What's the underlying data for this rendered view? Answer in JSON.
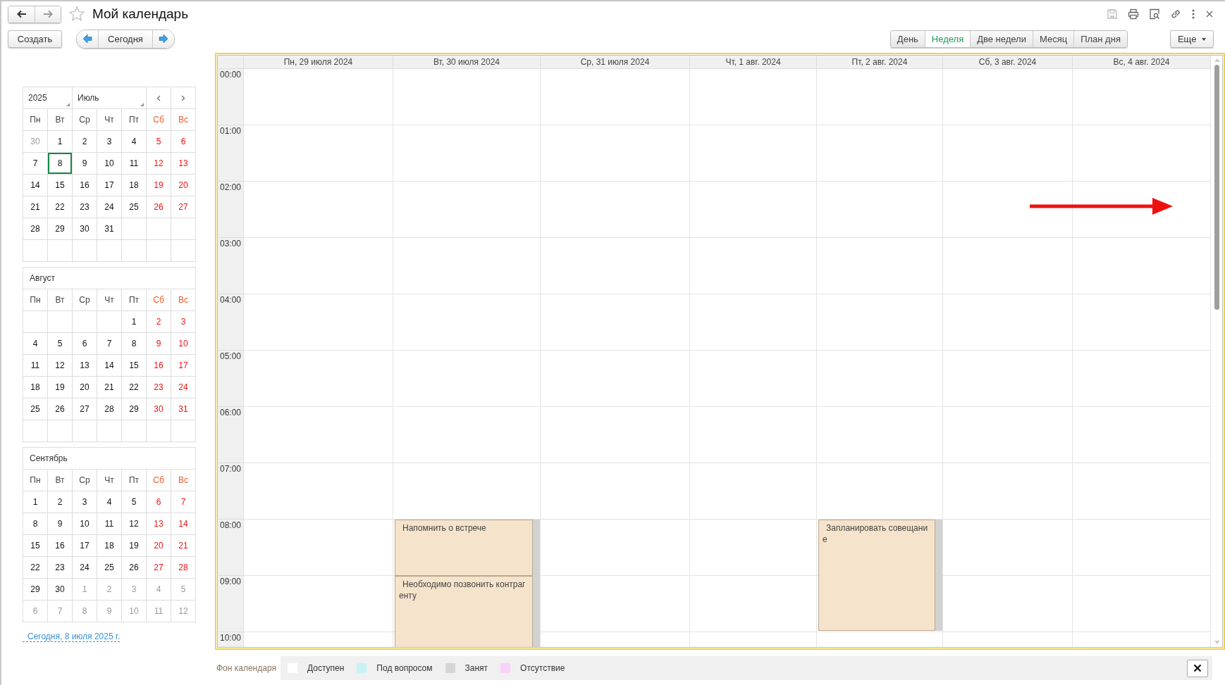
{
  "window": {
    "title": "Мой календарь",
    "favorite": false
  },
  "toolbar": {
    "create": "Создать",
    "today": "Сегодня",
    "more": "Еще",
    "views": [
      {
        "label": "День",
        "selected": false
      },
      {
        "label": "Неделя",
        "selected": true
      },
      {
        "label": "Две недели",
        "selected": false
      },
      {
        "label": "Месяц",
        "selected": false
      },
      {
        "label": "План дня",
        "selected": false
      }
    ]
  },
  "mini_calendars": [
    {
      "kind": "selector",
      "year": "2025",
      "month": "Июль",
      "weekdays": [
        {
          "label": "Пн",
          "weekend": false
        },
        {
          "label": "Вт",
          "weekend": false
        },
        {
          "label": "Ср",
          "weekend": false
        },
        {
          "label": "Чт",
          "weekend": false
        },
        {
          "label": "Пт",
          "weekend": false
        },
        {
          "label": "Сб",
          "weekend": true
        },
        {
          "label": "Вс",
          "weekend": true
        }
      ],
      "weeks": [
        [
          {
            "kind": "other",
            "text": "30",
            "selected": false
          },
          {
            "kind": "day",
            "text": "1",
            "selected": false
          },
          {
            "kind": "day",
            "text": "2",
            "selected": false
          },
          {
            "kind": "day",
            "text": "3",
            "selected": false
          },
          {
            "kind": "day",
            "text": "4",
            "selected": false
          },
          {
            "kind": "day",
            "text": "5",
            "selected": false
          },
          {
            "kind": "day",
            "text": "6",
            "selected": false
          }
        ],
        [
          {
            "kind": "day",
            "text": "7",
            "selected": false
          },
          {
            "kind": "day",
            "text": "8",
            "selected": true
          },
          {
            "kind": "day",
            "text": "9",
            "selected": false
          },
          {
            "kind": "day",
            "text": "10",
            "selected": false
          },
          {
            "kind": "day",
            "text": "11",
            "selected": false
          },
          {
            "kind": "day",
            "text": "12",
            "selected": false
          },
          {
            "kind": "day",
            "text": "13",
            "selected": false
          }
        ],
        [
          {
            "kind": "day",
            "text": "14",
            "selected": false
          },
          {
            "kind": "day",
            "text": "15",
            "selected": false
          },
          {
            "kind": "day",
            "text": "16",
            "selected": false
          },
          {
            "kind": "day",
            "text": "17",
            "selected": false
          },
          {
            "kind": "day",
            "text": "18",
            "selected": false
          },
          {
            "kind": "day",
            "text": "19",
            "selected": false
          },
          {
            "kind": "day",
            "text": "20",
            "selected": false
          }
        ],
        [
          {
            "kind": "day",
            "text": "21",
            "selected": false
          },
          {
            "kind": "day",
            "text": "22",
            "selected": false
          },
          {
            "kind": "day",
            "text": "23",
            "selected": false
          },
          {
            "kind": "day",
            "text": "24",
            "selected": false
          },
          {
            "kind": "day",
            "text": "25",
            "selected": false
          },
          {
            "kind": "day",
            "text": "26",
            "selected": false
          },
          {
            "kind": "day",
            "text": "27",
            "selected": false
          }
        ],
        [
          {
            "kind": "day",
            "text": "28",
            "selected": false
          },
          {
            "kind": "day",
            "text": "29",
            "selected": false
          },
          {
            "kind": "day",
            "text": "30",
            "selected": false
          },
          {
            "kind": "day",
            "text": "31",
            "selected": false
          },
          {
            "kind": "empty",
            "selected": false
          },
          {
            "kind": "empty",
            "selected": false
          },
          {
            "kind": "empty",
            "selected": false
          }
        ],
        [
          {
            "kind": "empty",
            "selected": false
          },
          {
            "kind": "empty",
            "selected": false
          },
          {
            "kind": "empty",
            "selected": false
          },
          {
            "kind": "empty",
            "selected": false
          },
          {
            "kind": "empty",
            "selected": false
          },
          {
            "kind": "empty",
            "selected": false
          },
          {
            "kind": "empty",
            "selected": false
          }
        ]
      ]
    },
    {
      "kind": "plain",
      "month": "Август",
      "weekdays": [
        {
          "label": "Пн",
          "weekend": false
        },
        {
          "label": "Вт",
          "weekend": false
        },
        {
          "label": "Ср",
          "weekend": false
        },
        {
          "label": "Чт",
          "weekend": false
        },
        {
          "label": "Пт",
          "weekend": false
        },
        {
          "label": "Сб",
          "weekend": true
        },
        {
          "label": "Вс",
          "weekend": true
        }
      ],
      "weeks": [
        [
          {
            "kind": "empty",
            "selected": false
          },
          {
            "kind": "empty",
            "selected": false
          },
          {
            "kind": "empty",
            "selected": false
          },
          {
            "kind": "empty",
            "selected": false
          },
          {
            "kind": "day",
            "text": "1",
            "selected": false
          },
          {
            "kind": "day",
            "text": "2",
            "selected": false
          },
          {
            "kind": "day",
            "text": "3",
            "selected": false
          }
        ],
        [
          {
            "kind": "day",
            "text": "4",
            "selected": false
          },
          {
            "kind": "day",
            "text": "5",
            "selected": false
          },
          {
            "kind": "day",
            "text": "6",
            "selected": false
          },
          {
            "kind": "day",
            "text": "7",
            "selected": false
          },
          {
            "kind": "day",
            "text": "8",
            "selected": false
          },
          {
            "kind": "day",
            "text": "9",
            "selected": false
          },
          {
            "kind": "day",
            "text": "10",
            "selected": false
          }
        ],
        [
          {
            "kind": "day",
            "text": "11",
            "selected": false
          },
          {
            "kind": "day",
            "text": "12",
            "selected": false
          },
          {
            "kind": "day",
            "text": "13",
            "selected": false
          },
          {
            "kind": "day",
            "text": "14",
            "selected": false
          },
          {
            "kind": "day",
            "text": "15",
            "selected": false
          },
          {
            "kind": "day",
            "text": "16",
            "selected": false
          },
          {
            "kind": "day",
            "text": "17",
            "selected": false
          }
        ],
        [
          {
            "kind": "day",
            "text": "18",
            "selected": false
          },
          {
            "kind": "day",
            "text": "19",
            "selected": false
          },
          {
            "kind": "day",
            "text": "20",
            "selected": false
          },
          {
            "kind": "day",
            "text": "21",
            "selected": false
          },
          {
            "kind": "day",
            "text": "22",
            "selected": false
          },
          {
            "kind": "day",
            "text": "23",
            "selected": false
          },
          {
            "kind": "day",
            "text": "24",
            "selected": false
          }
        ],
        [
          {
            "kind": "day",
            "text": "25",
            "selected": false
          },
          {
            "kind": "day",
            "text": "26",
            "selected": false
          },
          {
            "kind": "day",
            "text": "27",
            "selected": false
          },
          {
            "kind": "day",
            "text": "28",
            "selected": false
          },
          {
            "kind": "day",
            "text": "29",
            "selected": false
          },
          {
            "kind": "day",
            "text": "30",
            "selected": false
          },
          {
            "kind": "day",
            "text": "31",
            "selected": false
          }
        ],
        [
          {
            "kind": "empty",
            "selected": false
          },
          {
            "kind": "empty",
            "selected": false
          },
          {
            "kind": "empty",
            "selected": false
          },
          {
            "kind": "empty",
            "selected": false
          },
          {
            "kind": "empty",
            "selected": false
          },
          {
            "kind": "empty",
            "selected": false
          },
          {
            "kind": "empty",
            "selected": false
          }
        ]
      ]
    },
    {
      "kind": "plain",
      "month": "Сентябрь",
      "weekdays": [
        {
          "label": "Пн",
          "weekend": false
        },
        {
          "label": "Вт",
          "weekend": false
        },
        {
          "label": "Ср",
          "weekend": false
        },
        {
          "label": "Чт",
          "weekend": false
        },
        {
          "label": "Пт",
          "weekend": false
        },
        {
          "label": "Сб",
          "weekend": true
        },
        {
          "label": "Вс",
          "weekend": true
        }
      ],
      "weeks": [
        [
          {
            "kind": "day",
            "text": "1",
            "selected": false
          },
          {
            "kind": "day",
            "text": "2",
            "selected": false
          },
          {
            "kind": "day",
            "text": "3",
            "selected": false
          },
          {
            "kind": "day",
            "text": "4",
            "selected": false
          },
          {
            "kind": "day",
            "text": "5",
            "selected": false
          },
          {
            "kind": "day",
            "text": "6",
            "selected": false
          },
          {
            "kind": "day",
            "text": "7",
            "selected": false
          }
        ],
        [
          {
            "kind": "day",
            "text": "8",
            "selected": false
          },
          {
            "kind": "day",
            "text": "9",
            "selected": false
          },
          {
            "kind": "day",
            "text": "10",
            "selected": false
          },
          {
            "kind": "day",
            "text": "11",
            "selected": false
          },
          {
            "kind": "day",
            "text": "12",
            "selected": false
          },
          {
            "kind": "day",
            "text": "13",
            "selected": false
          },
          {
            "kind": "day",
            "text": "14",
            "selected": false
          }
        ],
        [
          {
            "kind": "day",
            "text": "15",
            "selected": false
          },
          {
            "kind": "day",
            "text": "16",
            "selected": false
          },
          {
            "kind": "day",
            "text": "17",
            "selected": false
          },
          {
            "kind": "day",
            "text": "18",
            "selected": false
          },
          {
            "kind": "day",
            "text": "19",
            "selected": false
          },
          {
            "kind": "day",
            "text": "20",
            "selected": false
          },
          {
            "kind": "day",
            "text": "21",
            "selected": false
          }
        ],
        [
          {
            "kind": "day",
            "text": "22",
            "selected": false
          },
          {
            "kind": "day",
            "text": "23",
            "selected": false
          },
          {
            "kind": "day",
            "text": "24",
            "selected": false
          },
          {
            "kind": "day",
            "text": "25",
            "selected": false
          },
          {
            "kind": "day",
            "text": "26",
            "selected": false
          },
          {
            "kind": "day",
            "text": "27",
            "selected": false
          },
          {
            "kind": "day",
            "text": "28",
            "selected": false
          }
        ],
        [
          {
            "kind": "day",
            "text": "29",
            "selected": false
          },
          {
            "kind": "day",
            "text": "30",
            "selected": false
          },
          {
            "kind": "other",
            "text": "1",
            "selected": false
          },
          {
            "kind": "other",
            "text": "2",
            "selected": false
          },
          {
            "kind": "other",
            "text": "3",
            "selected": false
          },
          {
            "kind": "other",
            "text": "4",
            "selected": false
          },
          {
            "kind": "other",
            "text": "5",
            "selected": false
          }
        ],
        [
          {
            "kind": "other",
            "text": "6",
            "selected": false
          },
          {
            "kind": "other",
            "text": "7",
            "selected": false
          },
          {
            "kind": "other",
            "text": "8",
            "selected": false
          },
          {
            "kind": "other",
            "text": "9",
            "selected": false
          },
          {
            "kind": "other",
            "text": "10",
            "selected": false
          },
          {
            "kind": "other",
            "text": "11",
            "selected": false
          },
          {
            "kind": "other",
            "text": "12",
            "selected": false
          }
        ]
      ]
    }
  ],
  "today_link": "Сегодня, 8 июля 2025 г.",
  "week": {
    "hours": [
      "00:00",
      "01:00",
      "02:00",
      "03:00",
      "04:00",
      "05:00",
      "06:00",
      "07:00",
      "08:00",
      "09:00",
      "10:00"
    ],
    "days": [
      {
        "label": "Пн, 29 июля 2024"
      },
      {
        "label": "Вт, 30 июля 2024",
        "slots": [
          {
            "kind": "free"
          },
          {
            "kind": "free"
          },
          {
            "kind": "free"
          },
          {
            "kind": "free"
          },
          {
            "kind": "free"
          },
          {
            "kind": "free"
          },
          {
            "kind": "free"
          },
          {
            "kind": "free"
          },
          {
            "kind": "hour_event",
            "title": "Напомнить о встрече"
          },
          {
            "kind": "open_event",
            "title": "Необходимо позвонить контрагенту"
          }
        ]
      },
      {
        "label": "Ср, 31 июля 2024"
      },
      {
        "label": "Чт, 1 авг. 2024"
      },
      {
        "label": "Пт, 2 авг. 2024",
        "slots": [
          {
            "kind": "free"
          },
          {
            "kind": "free"
          },
          {
            "kind": "free"
          },
          {
            "kind": "free"
          },
          {
            "kind": "free"
          },
          {
            "kind": "free"
          },
          {
            "kind": "free"
          },
          {
            "kind": "free"
          },
          {
            "kind": "two_hour_event",
            "title": "Запланировать совещание"
          }
        ]
      },
      {
        "label": "Сб, 3 авг. 2024"
      },
      {
        "label": "Вс, 4 авг. 2024"
      }
    ]
  },
  "legend": {
    "title": "Фон календаря",
    "items": [
      {
        "label": "Доступен",
        "color": "#ffffff"
      },
      {
        "label": "Под вопросом",
        "color": "#c6f4f7"
      },
      {
        "label": "Занят",
        "color": "#d6d6d6"
      },
      {
        "label": "Отсутствие",
        "color": "#fad2f9"
      }
    ]
  }
}
